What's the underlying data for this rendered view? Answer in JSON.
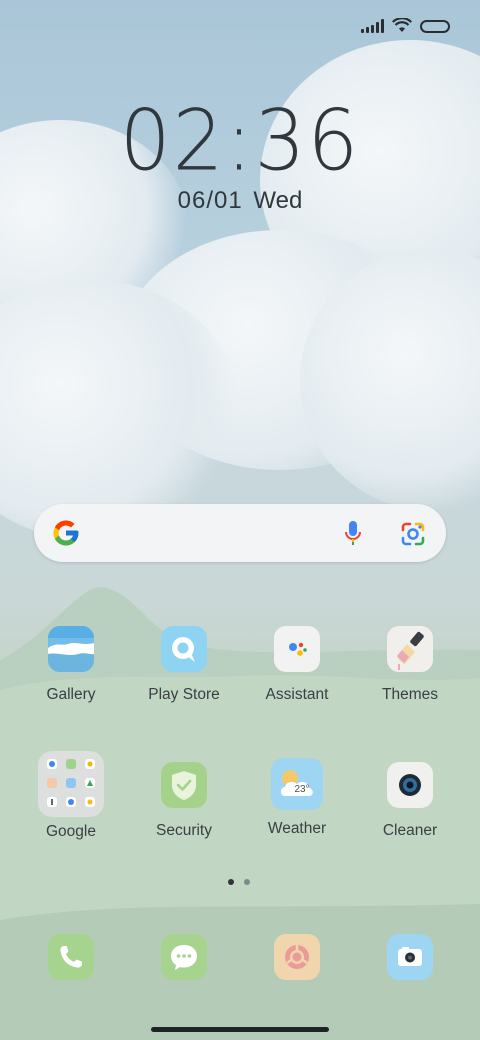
{
  "status_bar": {
    "signal_icon": "signal-icon",
    "wifi_icon": "wifi-icon",
    "battery_icon": "battery-icon"
  },
  "lockscreen_clock": {
    "time": "02:36",
    "date": "06/01",
    "weekday": "Wed"
  },
  "search_bar": {
    "logo_icon": "google-g-icon",
    "mic_icon": "microphone-icon",
    "lens_icon": "google-lens-icon"
  },
  "apps": [
    {
      "label": "Gallery",
      "icon": "gallery-icon"
    },
    {
      "label": "Play Store",
      "icon": "play-store-icon"
    },
    {
      "label": "Assistant",
      "icon": "assistant-icon"
    },
    {
      "label": "Themes",
      "icon": "themes-brush-icon"
    },
    {
      "label": "Google",
      "icon": "google-folder-icon"
    },
    {
      "label": "Security",
      "icon": "security-shield-icon"
    },
    {
      "label": "Weather",
      "icon": "weather-icon",
      "temperature": "23°"
    },
    {
      "label": "Cleaner",
      "icon": "cleaner-icon"
    }
  ],
  "dock": [
    {
      "icon": "phone-icon"
    },
    {
      "icon": "messages-icon"
    },
    {
      "icon": "browser-icon"
    },
    {
      "icon": "camera-icon"
    }
  ],
  "page_indicator": {
    "pages": 2,
    "current": 1
  },
  "colors": {
    "text_dark": "#30373d",
    "label": "#3a4046",
    "searchbar_bg": "#f3f4f5",
    "dot_active": "#2e3338",
    "dot_inactive": "#7e8a86"
  }
}
